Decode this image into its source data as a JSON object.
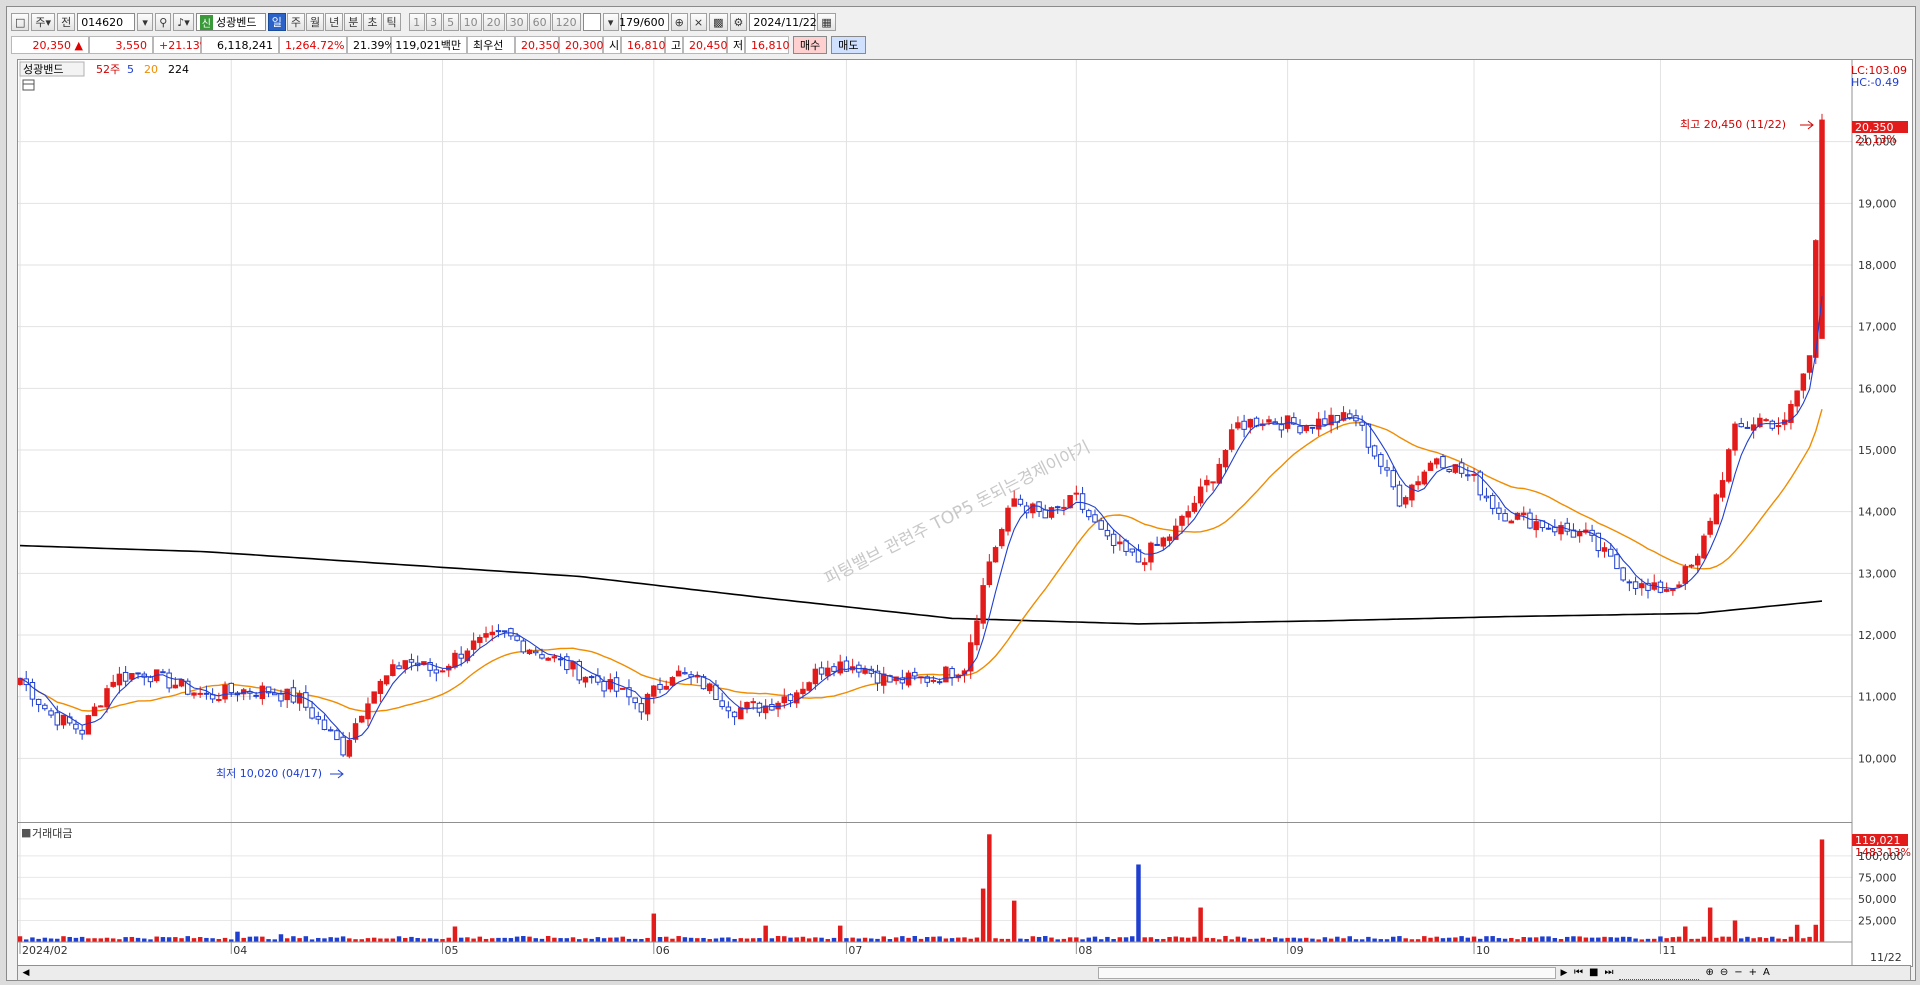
{
  "toolbar": {
    "type_label": "주",
    "market_label": "전",
    "code": "014620",
    "indicator_badge": "신",
    "indicator_name": "성광벤드",
    "periods": [
      "일",
      "주",
      "월",
      "년",
      "분",
      "초",
      "틱"
    ],
    "period_selected": "일",
    "intervals": [
      "1",
      "3",
      "5",
      "10",
      "20",
      "30",
      "60",
      "120"
    ],
    "count": "179/600",
    "date": "2024/11/22"
  },
  "quote": {
    "price": "20,350",
    "change": "3,550",
    "change_pct": "+21.13%",
    "volume": "6,118,241",
    "volume_pct": "1,264.72%",
    "turnover": "21.39%",
    "amount": "119,021백만",
    "best_label": "최우선",
    "best_ask": "20,350",
    "best_bid": "20,300",
    "open_label": "시",
    "open": "16,810",
    "high_label": "고",
    "high": "20,450",
    "low_label": "저",
    "low": "16,810",
    "buy_label": "매수",
    "sell_label": "매도"
  },
  "chart": {
    "legend_title": "성광밴드",
    "legend_items": [
      {
        "label": "52주",
        "color": "#d00000"
      },
      {
        "label": "5",
        "color": "#1f3fd0"
      },
      {
        "label": "20",
        "color": "#f08c00"
      },
      {
        "label": "224",
        "color": "#000000"
      }
    ],
    "lc": "LC:103.09",
    "hc": "HC:-0.49",
    "max_label": "최고 20,450 (11/22)",
    "min_label": "최저 10,020 (04/17)",
    "last_price": "20,350",
    "last_pct": "21.13%",
    "volume_panel_title": "거래대금",
    "vol_last": "119,021",
    "vol_pct": "1483.13%",
    "watermark": "피팅밸브 관련주 TOP5 돈되는경제이야기",
    "bottom_date": "11/22",
    "colors": {
      "up": "#e21b1b",
      "down": "#1f3fd0",
      "ma5": "#1f3fd0",
      "ma20": "#f08c00",
      "ma224": "#000000"
    }
  },
  "chart_data": {
    "type": "candlestick",
    "y_ticks": [
      10000,
      11000,
      12000,
      13000,
      14000,
      15000,
      16000,
      17000,
      18000,
      19000,
      20000
    ],
    "y_tick_labels": [
      "10,000",
      "11,000",
      "12,000",
      "13,000",
      "14,000",
      "15,000",
      "16,000",
      "17,000",
      "18,000",
      "19,000",
      "20,000"
    ],
    "ylim": [
      9000,
      21000
    ],
    "x_labels": [
      "2024/02",
      "04",
      "05",
      "06",
      "07",
      "08",
      "09",
      "10",
      "11"
    ],
    "x_label_index": [
      0,
      34,
      68,
      102,
      133,
      170,
      204,
      234,
      264
    ],
    "volume_ticks": [
      "25,000",
      "50,000",
      "75,000",
      "100,000"
    ],
    "volume_tick_values": [
      25000,
      50000,
      75000,
      100000
    ],
    "volume_max": 130000,
    "price_anchors": [
      [
        0,
        11300
      ],
      [
        5,
        10700
      ],
      [
        10,
        10450
      ],
      [
        15,
        11300
      ],
      [
        20,
        11400
      ],
      [
        25,
        11200
      ],
      [
        30,
        11000
      ],
      [
        35,
        11100
      ],
      [
        40,
        11100
      ],
      [
        45,
        10950
      ],
      [
        52,
        10150
      ],
      [
        56,
        11000
      ],
      [
        62,
        11600
      ],
      [
        67,
        11400
      ],
      [
        72,
        11800
      ],
      [
        78,
        12000
      ],
      [
        84,
        11700
      ],
      [
        90,
        11400
      ],
      [
        96,
        11100
      ],
      [
        100,
        10850
      ],
      [
        105,
        11400
      ],
      [
        110,
        11200
      ],
      [
        115,
        10800
      ],
      [
        120,
        10850
      ],
      [
        125,
        11100
      ],
      [
        130,
        11550
      ],
      [
        135,
        11500
      ],
      [
        140,
        11250
      ],
      [
        147,
        11300
      ],
      [
        152,
        11500
      ],
      [
        156,
        13200
      ],
      [
        160,
        14200
      ],
      [
        165,
        13900
      ],
      [
        170,
        14200
      ],
      [
        175,
        13500
      ],
      [
        180,
        13200
      ],
      [
        186,
        13700
      ],
      [
        192,
        14600
      ],
      [
        196,
        15400
      ],
      [
        200,
        15500
      ],
      [
        206,
        15400
      ],
      [
        211,
        15500
      ],
      [
        215,
        15500
      ],
      [
        222,
        14200
      ],
      [
        228,
        14900
      ],
      [
        234,
        14500
      ],
      [
        238,
        14000
      ],
      [
        245,
        13800
      ],
      [
        252,
        13600
      ],
      [
        258,
        13000
      ],
      [
        262,
        12700
      ],
      [
        266,
        12800
      ],
      [
        270,
        13200
      ],
      [
        272,
        13900
      ],
      [
        276,
        15300
      ],
      [
        280,
        15500
      ],
      [
        284,
        15400
      ],
      [
        288,
        16500
      ],
      [
        290,
        20350
      ]
    ],
    "ma224_anchors": [
      [
        0,
        13450
      ],
      [
        30,
        13350
      ],
      [
        60,
        13150
      ],
      [
        90,
        12950
      ],
      [
        120,
        12600
      ],
      [
        150,
        12270
      ],
      [
        180,
        12180
      ],
      [
        210,
        12230
      ],
      [
        240,
        12300
      ],
      [
        270,
        12350
      ],
      [
        290,
        12550
      ]
    ],
    "volume_spikes": [
      [
        35,
        12000
      ],
      [
        42,
        9000
      ],
      [
        70,
        18000
      ],
      [
        102,
        33000
      ],
      [
        120,
        19000
      ],
      [
        132,
        19000
      ],
      [
        155,
        62000
      ],
      [
        156,
        125000
      ],
      [
        160,
        48000
      ],
      [
        180,
        90000
      ],
      [
        190,
        40000
      ],
      [
        268,
        18000
      ],
      [
        272,
        40000
      ],
      [
        276,
        25000
      ],
      [
        286,
        20000
      ],
      [
        289,
        20000
      ],
      [
        290,
        119021
      ]
    ]
  }
}
